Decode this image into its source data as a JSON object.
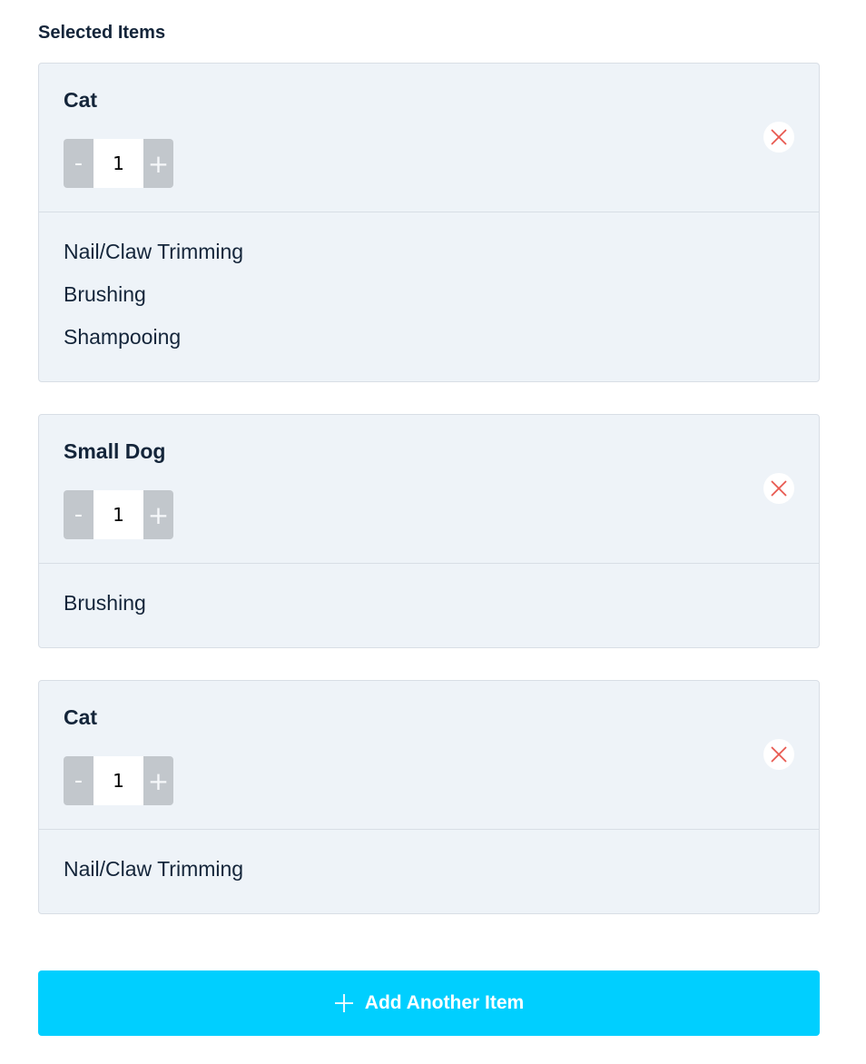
{
  "section": {
    "title": "Selected Items"
  },
  "items": [
    {
      "name": "Cat",
      "quantity": "1",
      "minus_label": "-",
      "plus_label": "+",
      "services": [
        "Nail/Claw Trimming",
        "Brushing",
        "Shampooing"
      ]
    },
    {
      "name": "Small Dog",
      "quantity": "1",
      "minus_label": "-",
      "plus_label": "+",
      "services": [
        "Brushing"
      ]
    },
    {
      "name": "Cat",
      "quantity": "1",
      "minus_label": "-",
      "plus_label": "+",
      "services": [
        "Nail/Claw Trimming"
      ]
    }
  ],
  "add_button": {
    "label": "Add Another Item",
    "icon": "plus-icon"
  },
  "colors": {
    "accent": "#00cfff",
    "card_bg": "#eef3f8",
    "remove_icon": "#e8584f",
    "stepper_btn": "#c2c7cc",
    "text": "#14253a"
  }
}
